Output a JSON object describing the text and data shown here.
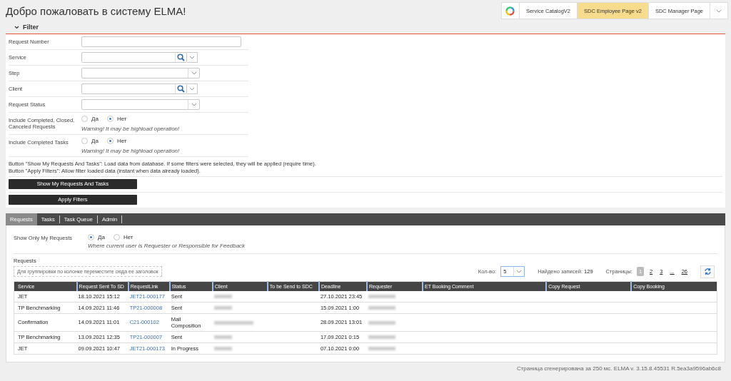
{
  "header": {
    "title": "Добро пожаловать в систему ELMA!",
    "apps": [
      {
        "label": "Service CatalogV2",
        "selected": false
      },
      {
        "label": "SDC Employee Page v2",
        "selected": true
      },
      {
        "label": "SDC Manager Page",
        "selected": false
      }
    ]
  },
  "filter": {
    "title": "Filter",
    "expanded": true,
    "fields": [
      {
        "label": "Request Number",
        "kind": "text"
      },
      {
        "label": "Service",
        "kind": "lookup"
      },
      {
        "label": "Step",
        "kind": "select"
      },
      {
        "label": "Client",
        "kind": "lookup"
      },
      {
        "label": "Request Status",
        "kind": "select"
      },
      {
        "label": "Include Completed, Closed, Canceled Requests",
        "kind": "radio",
        "options": [
          {
            "label": "Да",
            "selected": false
          },
          {
            "label": "Нет",
            "selected": true
          }
        ],
        "note": "Warning! It may be highload operation!"
      },
      {
        "label": "Include Completed Tasks",
        "kind": "radio",
        "options": [
          {
            "label": "Да",
            "selected": false
          },
          {
            "label": "Нет",
            "selected": true
          }
        ],
        "note": "Warning! It may be highload operation!"
      }
    ],
    "help": [
      "Button \"Show My Requests And Tasks\": Load data from database. If some filters were selected, they will be applied (require time).",
      "Button \"Apply Filters\": Allow filter loaded data (instant when data already loaded)."
    ],
    "buttons": [
      "Show My Requests And Tasks",
      "Apply Filters"
    ]
  },
  "tabs": [
    {
      "label": "Requests",
      "selected": true
    },
    {
      "label": "Tasks",
      "selected": false
    },
    {
      "label": "Task Queue",
      "selected": false
    },
    {
      "label": "Admin",
      "selected": false
    }
  ],
  "my_requests": {
    "label": "Show Only My Requests",
    "options": [
      {
        "label": "Да",
        "selected": true
      },
      {
        "label": "Нет",
        "selected": false
      }
    ],
    "note": "Where current user is Requester or Responsible for Feedback"
  },
  "grid": {
    "title": "Requests",
    "group_hint": "Для группировки по колонке переместите сюда ее заголовок",
    "page_size_label": "Кол-во:",
    "page_size": "5",
    "found_label": "Найдено записей:",
    "found": "129",
    "pages_label": "Страницы:",
    "pages": [
      {
        "label": "1",
        "selected": true
      },
      {
        "label": "2",
        "selected": false
      },
      {
        "label": "3",
        "selected": false
      },
      {
        "label": "...",
        "selected": false
      },
      {
        "label": "26",
        "selected": false
      }
    ],
    "columns": [
      "Service",
      "Request Sent To SD",
      "RequestLink",
      "Status",
      "Client",
      "To be Send to SDC",
      "Deadline",
      "Requester",
      "ET Booking Comment",
      "Copy Request",
      "Copy Booking"
    ],
    "rows": [
      {
        "service": "JET",
        "sent": "18.10.2021 15:12",
        "link": "JET21-000177",
        "status": "Sent",
        "client_redacted": true,
        "deadline": "27.10.2021 23:45",
        "requester_redacted": true
      },
      {
        "service": "TP Benchmarking",
        "sent": "14.09.2021 11:46",
        "link": "TP21-000008",
        "status": "Sent",
        "client_redacted": true,
        "deadline": "15.09.2021 1:00",
        "requester_redacted": true
      },
      {
        "service": "Confirmation",
        "sent": "14.09.2021 11:01",
        "link": "C21-000102",
        "status": "Mail Composition",
        "client_redacted": true,
        "deadline": "28.09.2021 13:01",
        "requester_redacted": true
      },
      {
        "service": "TP Benchmarking",
        "sent": "13.09.2021 12:35",
        "link": "TP21-000007",
        "status": "Sent",
        "client_redacted": true,
        "deadline": "17.09.2021 0:15",
        "requester_redacted": true
      },
      {
        "service": "JET",
        "sent": "09.09.2021 10:47",
        "link": "JET21-000173",
        "status": "In Progress",
        "client_redacted": true,
        "deadline": "07.10.2021 0:00",
        "requester_redacted": true
      }
    ]
  },
  "footer": "Страница сгенерирована за 250 мс. ELMA v. 3.15.8.45531 R.5ea3a9596ab6c8"
}
